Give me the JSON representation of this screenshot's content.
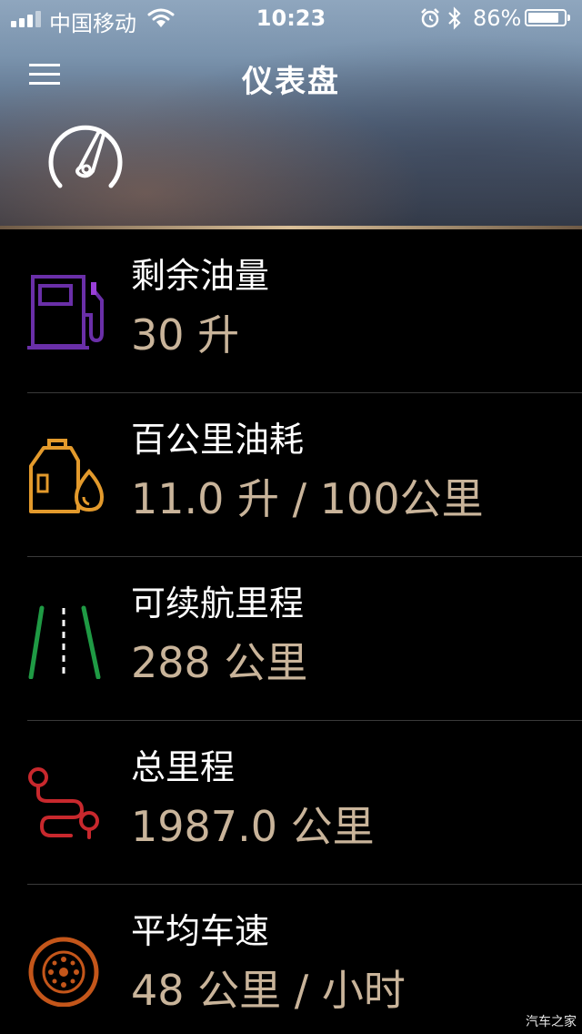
{
  "status_bar": {
    "carrier": "中国移动",
    "time": "10:23",
    "battery_percent": "86%",
    "battery_level": 0.86
  },
  "header": {
    "title": "仪表盘"
  },
  "items": [
    {
      "label": "剩余油量",
      "value": "30 升",
      "icon": "fuel-pump-icon",
      "color": "#6a2fa8"
    },
    {
      "label": "百公里油耗",
      "value": "11.0 升 / 100公里",
      "icon": "oil-can-icon",
      "color": "#e39a2c"
    },
    {
      "label": "可续航里程",
      "value": "288 公里",
      "icon": "road-icon",
      "color": "#1f9a44"
    },
    {
      "label": "总里程",
      "value": "1987.0 公里",
      "icon": "route-icon",
      "color": "#c8282d"
    },
    {
      "label": "平均车速",
      "value": "48 公里 / 小时",
      "icon": "tire-icon",
      "color": "#c4561a"
    }
  ],
  "watermark": "汽车之家"
}
